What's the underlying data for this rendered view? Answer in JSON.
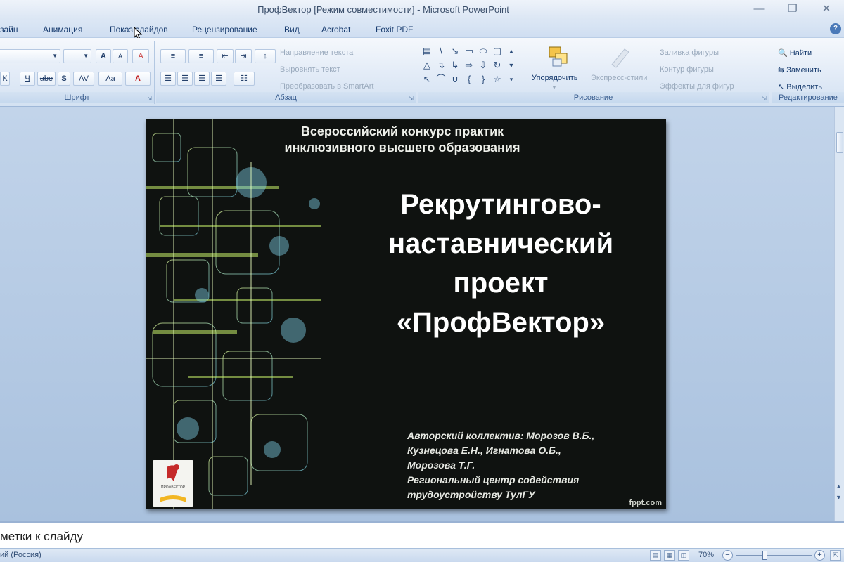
{
  "window": {
    "title": "ПрофВектор [Режим совместимости] - Microsoft PowerPoint"
  },
  "tabs": [
    "зайн",
    "Анимация",
    "Показ слайдов",
    "Рецензирование",
    "Вид",
    "Acrobat",
    "Foxit PDF"
  ],
  "ribbon": {
    "font_group": {
      "label": "Шрифт",
      "grow_label": "A",
      "shrink_label": "A",
      "clear_label": "A",
      "underline_label": "Ч",
      "strike_label": "abe",
      "shadow_label": "S",
      "spacing_label": "AV",
      "case_label": "Aa",
      "color_label": "A"
    },
    "paragraph_group": {
      "label": "Абзац",
      "text_direction": "Направление текста",
      "align_text": "Выровнять текст",
      "convert_smartart": "Преобразовать в SmartArt"
    },
    "drawing_group": {
      "label": "Рисование",
      "arrange": "Упорядочить",
      "quick_styles": "Экспресс-стили",
      "shape_fill": "Заливка фигуры",
      "shape_outline": "Контур фигуры",
      "shape_effects": "Эффекты для фигур"
    },
    "editing_group": {
      "label": "Редактирование",
      "find": "Найти",
      "replace": "Заменить",
      "select": "Выделить"
    }
  },
  "slide": {
    "subtitle_line1": "Всероссийский конкурс практик",
    "subtitle_line2": "инклюзивного высшего образования",
    "title_lines": [
      "Рекрутингово-",
      "наставнический",
      "проект",
      "«ПрофВектор»"
    ],
    "author_lines": [
      "Авторский коллектив: Морозов В.Б.,",
      "Кузнецова Е.Н.,  Игнатова О.Б.,",
      "Морозова Т.Г.",
      "Региональный центр содействия",
      "трудоустройству ТулГУ"
    ],
    "watermark": "fppt.com",
    "logo_text": "ПРОФВЕКТОР",
    "colors": {
      "background": "#0f1210",
      "accent": "#c9f06a"
    }
  },
  "notes": {
    "placeholder": "метки к слайду"
  },
  "status": {
    "language": "ий (Россия)",
    "zoom_level": "70%",
    "zoom_out": "−",
    "zoom_in": "+"
  },
  "icons": [
    "minimize-icon",
    "restore-icon",
    "close-icon",
    "help-icon",
    "fit-window-icon"
  ]
}
